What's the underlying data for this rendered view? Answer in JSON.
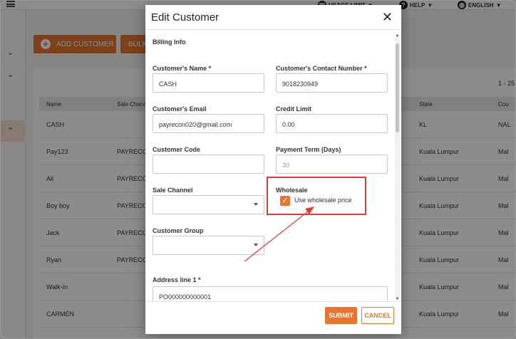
{
  "topbar": {
    "usage_limit": "USAGE LIMIT",
    "help": "HELP",
    "language": "ENGLISH"
  },
  "toolbar": {
    "add_customer": "ADD CUSTOMER",
    "bulk": "BULK"
  },
  "table": {
    "pager": "1 - 25",
    "columns": [
      "Name",
      "Sale Chann",
      "State",
      "Cou"
    ],
    "rows": [
      {
        "name": "CASH",
        "channel": "",
        "state": "KL",
        "country": "NAL"
      },
      {
        "name": "Pay123",
        "channel": "PAYRECO",
        "state": "Kuala Lumpur",
        "country": "Mal"
      },
      {
        "name": "Ali",
        "channel": "PAYRECO",
        "state": "Kuala Lumpur",
        "country": "Mal"
      },
      {
        "name": "Boy boy",
        "channel": "PAYRECO",
        "state": "Kuala Lumpur",
        "country": "Mal"
      },
      {
        "name": "Jack",
        "channel": "PAYRECO",
        "state": "Kuala Lumpur",
        "country": "Mal"
      },
      {
        "name": "Ryan",
        "channel": "PAYRECO",
        "state": "Kuala Lumpur",
        "country": "Mal"
      },
      {
        "name": "Walk-In",
        "channel": "",
        "state": "Kuala Lumpur",
        "country": "Mal"
      },
      {
        "name": "CARMEN",
        "channel": "",
        "state": "Kuala Lumpur",
        "country": "Mal"
      }
    ]
  },
  "modal": {
    "title": "Edit Customer",
    "section": "Billing Info",
    "name_label": "Customer's Name *",
    "name_value": "CASH",
    "contact_label": "Customer's Contact Number *",
    "contact_value": "9018230949",
    "email_label": "Customer's Email",
    "email_value": "payrecon020@gmail.com",
    "credit_label": "Credit Limit",
    "credit_value": "0.00",
    "code_label": "Customer Code",
    "code_value": "",
    "payment_label": "Payment Term (Days)",
    "payment_value": "30",
    "sale_channel_label": "Sale Channel",
    "sale_channel_value": "",
    "wholesale_title": "Wholesale",
    "wholesale_checkbox_label": "Use wholesale price",
    "wholesale_checked": true,
    "group_label": "Customer Group",
    "group_value": "",
    "address1_label": "Address line 1 *",
    "address1_value": "PO000000000001",
    "submit": "SUBMIT",
    "cancel": "CANCEL"
  },
  "colors": {
    "accent": "#e8742e",
    "highlight": "#e53935"
  }
}
